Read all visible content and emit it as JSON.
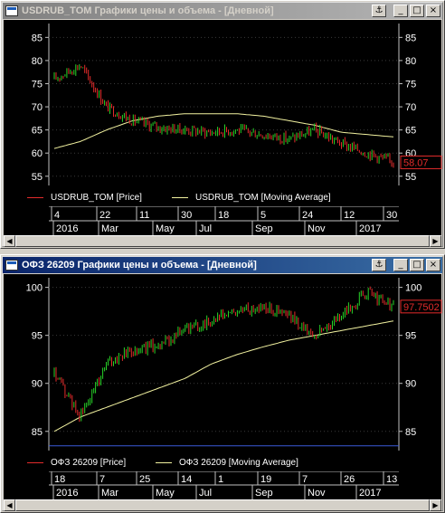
{
  "windows": [
    {
      "title": "USDRUB_TOM Графики цены и объема - [Дневной]",
      "active": false,
      "price_label": "58.07",
      "y_ticks": [
        55,
        60,
        65,
        70,
        75,
        80,
        85
      ],
      "legend": {
        "price": "USDRUB_TOM [Price]",
        "ma": "USDRUB_TOM [Moving Average]"
      },
      "time_top": [
        "4",
        "22",
        "11",
        "30",
        "18",
        "5",
        "24",
        "12",
        "30"
      ],
      "time_bottom": [
        "2016",
        "Mar",
        "May",
        "Jul",
        "Sep",
        "Nov",
        "2017"
      ],
      "colors": {
        "price_up": "#27d327",
        "price_down": "#e32b2b",
        "ma": "#f2f2a0",
        "legend_price": "#e32b2b",
        "legend_ma": "#f2f2a0"
      }
    },
    {
      "title": "ОФЗ 26209 Графики цены и объема - [Дневной]",
      "active": true,
      "price_label": "97.7502",
      "y_ticks": [
        85,
        90,
        95,
        100
      ],
      "legend": {
        "price": "ОФЗ 26209 [Price]",
        "ma": "ОФЗ 26209 [Moving Average]"
      },
      "time_top": [
        "18",
        "7",
        "25",
        "14",
        "1",
        "19",
        "7",
        "26",
        "13"
      ],
      "time_bottom": [
        "2016",
        "Mar",
        "May",
        "Jul",
        "Sep",
        "Nov",
        "2017"
      ],
      "colors": {
        "price_up": "#27d327",
        "price_down": "#e32b2b",
        "ma": "#f2f2a0",
        "legend_price": "#e32b2b",
        "legend_ma": "#f2f2a0",
        "hline": "#3b5bd8"
      }
    }
  ],
  "title_buttons": {
    "anchor": "⚓",
    "minimize": "_",
    "maximize": "□",
    "close": "×"
  },
  "chart_data": [
    {
      "type": "line",
      "series": [
        {
          "name": "USDRUB_TOM [Price]",
          "x": [
            "2016-01",
            "2016-02",
            "2016-03",
            "2016-04",
            "2016-05",
            "2016-06",
            "2016-07",
            "2016-08",
            "2016-09",
            "2016-10",
            "2016-11",
            "2016-12",
            "2017-01",
            "2017-02"
          ],
          "values": [
            76,
            79,
            70,
            67,
            65.5,
            65,
            64.5,
            65,
            64,
            63,
            65,
            62,
            60,
            58
          ]
        },
        {
          "name": "USDRUB_TOM [Moving Average]",
          "x": [
            "2016-01",
            "2016-02",
            "2016-03",
            "2016-04",
            "2016-05",
            "2016-06",
            "2016-07",
            "2016-08",
            "2016-09",
            "2016-10",
            "2016-11",
            "2016-12",
            "2017-01",
            "2017-02"
          ],
          "values": [
            61,
            62.5,
            65,
            67,
            68,
            68.5,
            68.5,
            68.5,
            68,
            67,
            66,
            64.5,
            64,
            63.5
          ]
        }
      ],
      "ylim": [
        53,
        88
      ],
      "y_ticks": [
        55,
        60,
        65,
        70,
        75,
        80,
        85
      ]
    },
    {
      "type": "line",
      "series": [
        {
          "name": "ОФЗ 26209 [Price]",
          "x": [
            "2016-01",
            "2016-02",
            "2016-03",
            "2016-04",
            "2016-05",
            "2016-06",
            "2016-07",
            "2016-08",
            "2016-09",
            "2016-10",
            "2016-11",
            "2016-12",
            "2017-01",
            "2017-02"
          ],
          "values": [
            91,
            86.5,
            92,
            93.5,
            94,
            95.5,
            96.5,
            97.5,
            98,
            97,
            95,
            97,
            99.5,
            98
          ]
        },
        {
          "name": "ОФЗ 26209 [Moving Average]",
          "x": [
            "2016-01",
            "2016-02",
            "2016-03",
            "2016-04",
            "2016-05",
            "2016-06",
            "2016-07",
            "2016-08",
            "2016-09",
            "2016-10",
            "2016-11",
            "2016-12",
            "2017-01",
            "2017-02"
          ],
          "values": [
            85,
            86.5,
            87.5,
            88.5,
            89.5,
            90.5,
            92,
            93,
            93.8,
            94.5,
            95,
            95.5,
            96,
            96.5
          ]
        }
      ],
      "ylim": [
        83,
        101
      ],
      "y_ticks": [
        85,
        90,
        95,
        100
      ]
    }
  ]
}
